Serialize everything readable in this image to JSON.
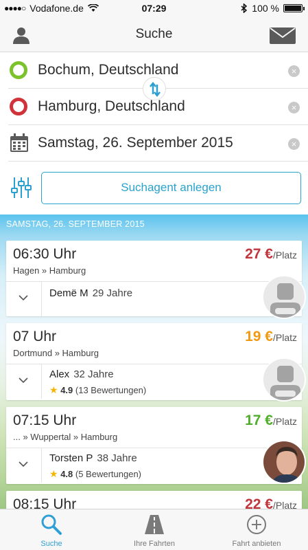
{
  "status_bar": {
    "carrier": "Vodafone.de",
    "time": "07:29",
    "battery": "100 %",
    "battery_level": 1.0
  },
  "nav": {
    "title": "Suche"
  },
  "search": {
    "from": "Bochum, Deutschland",
    "to": "Hamburg, Deutschland",
    "date": "Samstag, 26. September 2015",
    "agent_button": "Suchagent anlegen"
  },
  "results": {
    "date_header": "SAMSTAG, 26. SEPTEMBER 2015",
    "rides": [
      {
        "time": "06:30 Uhr",
        "route": "Hagen » Hamburg",
        "price": "27 €",
        "per": "/Platz",
        "price_color": "#c0363c",
        "driver": "Demë M",
        "age": "29 Jahre"
      },
      {
        "time": "07 Uhr",
        "route": "Dortmund » Hamburg",
        "price": "19 €",
        "per": "/Platz",
        "price_color": "#f09a12",
        "driver": "Alex",
        "age": "32 Jahre",
        "rating": "4.9",
        "reviews": "(13 Bewertungen)"
      },
      {
        "time": "07:15 Uhr",
        "route": "... » Wuppertal » Hamburg",
        "price": "17 €",
        "per": "/Platz",
        "price_color": "#4fae2a",
        "driver": "Torsten P",
        "age": "38 Jahre",
        "rating": "4.8",
        "reviews": "(5 Bewertungen)"
      },
      {
        "time": "08:15 Uhr",
        "price": "22 €",
        "per": "/Platz",
        "price_color": "#c0363c"
      }
    ]
  },
  "tabs": [
    {
      "label": "Suche",
      "icon": "search-icon",
      "active": true
    },
    {
      "label": "Ihre Fahrten",
      "icon": "road-icon",
      "active": false
    },
    {
      "label": "Fahrt anbieten",
      "icon": "plus-circle-icon",
      "active": false
    }
  ],
  "colors": {
    "accent": "#29a3cc",
    "origin": "#7bc22b",
    "destination": "#d0343a"
  }
}
